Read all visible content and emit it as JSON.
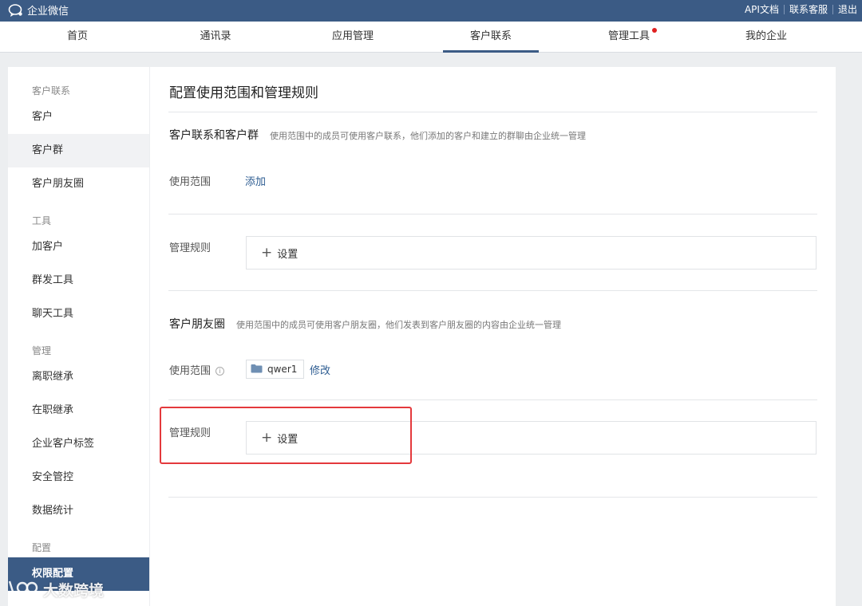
{
  "topbar": {
    "brand": "企业微信",
    "links": [
      "API文档",
      "联系客服",
      "退出"
    ]
  },
  "nav": {
    "items": [
      "首页",
      "通讯录",
      "应用管理",
      "客户联系",
      "管理工具",
      "我的企业"
    ],
    "active": "客户联系",
    "badge_on": "管理工具",
    "accent_color": "#3b5b85",
    "badge_color": "#e02020"
  },
  "sidebar": {
    "groups": {
      "contact": "客户联系",
      "tools": "工具",
      "manage": "管理",
      "config": "配置"
    },
    "items": {
      "customer": "客户",
      "customer_group": "客户群",
      "moments": "客户朋友圈",
      "add_customer": "加客户",
      "broadcast": "群发工具",
      "chat_tools": "聊天工具",
      "resign_transfer": "离职继承",
      "active_transfer": "在职继承",
      "tags": "企业客户标签",
      "security": "安全管控",
      "stats": "数据统计",
      "permissions": "权限配置"
    },
    "selected": "权限配置"
  },
  "main": {
    "title": "配置使用范围和管理规则",
    "section1": {
      "title": "客户联系和客户群",
      "desc": "使用范围中的成员可使用客户联系，他们添加的客户和建立的群聊由企业统一管理",
      "scope_label": "使用范围",
      "add_link": "添加",
      "rules_label": "管理规则",
      "set_label": "设置"
    },
    "section2": {
      "title": "客户朋友圈",
      "desc": "使用范围中的成员可使用客户朋友圈，他们发表到客户朋友圈的内容由企业统一管理",
      "scope_label": "使用范围",
      "info_glyph": "i",
      "chip_label": "qwer1",
      "edit_link": "修改",
      "rules_label": "管理规则",
      "set_label": "设置"
    }
  },
  "watermark": "大数跨境",
  "icons": {
    "brand": "wecom-chat-bubble-icon",
    "folder": "folder-icon",
    "plus": "plus-icon",
    "info": "info-icon"
  }
}
